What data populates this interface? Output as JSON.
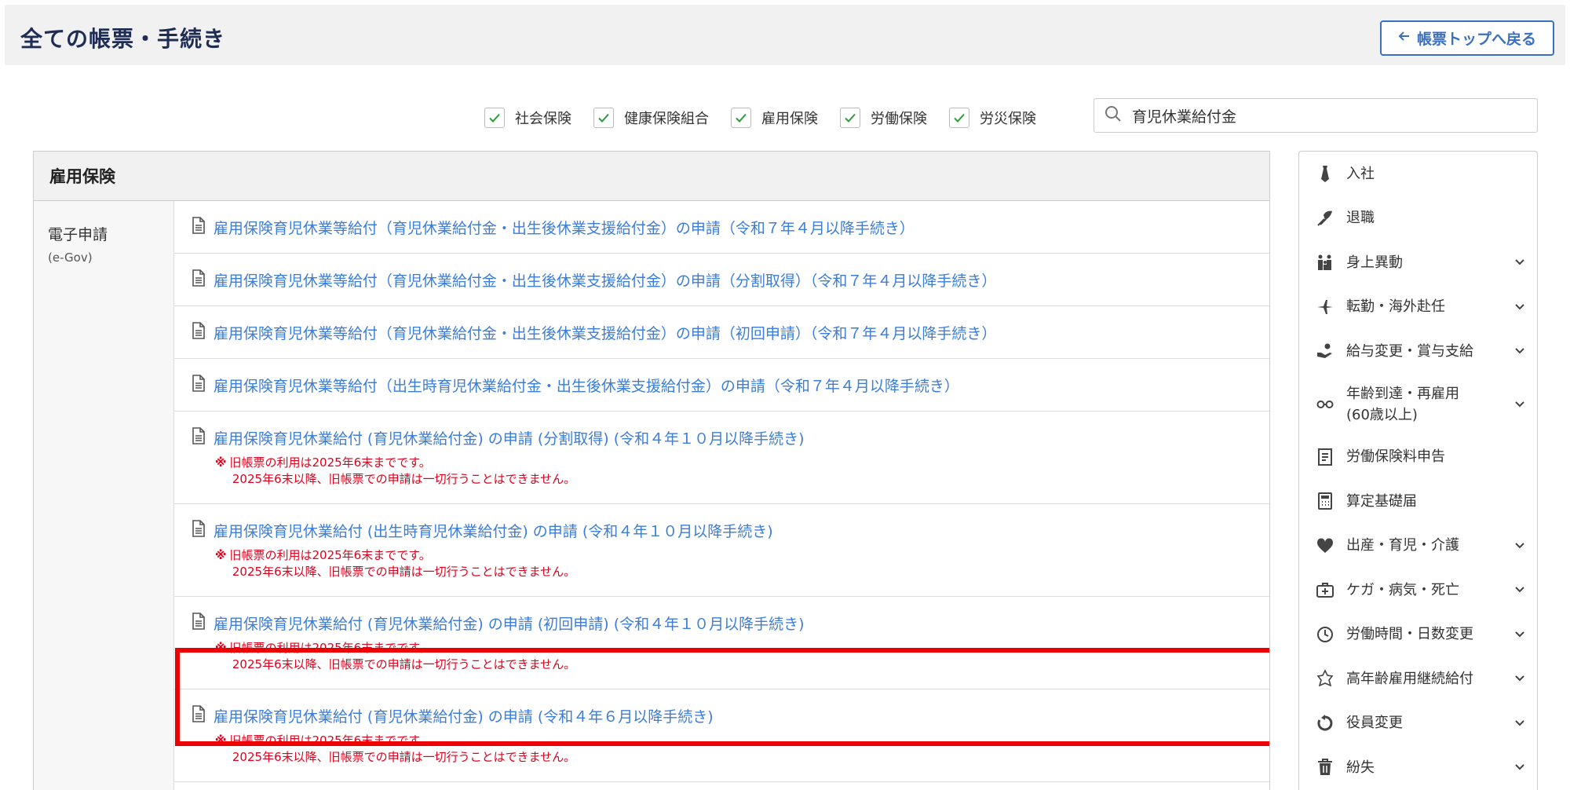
{
  "header": {
    "title": "全ての帳票・手続き",
    "back_label": "帳票トップへ戻る"
  },
  "filters": [
    {
      "label": "社会保険",
      "checked": true
    },
    {
      "label": "健康保険組合",
      "checked": true
    },
    {
      "label": "雇用保険",
      "checked": true
    },
    {
      "label": "労働保険",
      "checked": true
    },
    {
      "label": "労災保険",
      "checked": true
    }
  ],
  "search": {
    "value": "育児休業給付金",
    "placeholder": ""
  },
  "section": {
    "title": "雇用保険",
    "label_main": "電子申請",
    "label_sub": "(e-Gov)",
    "items": [
      {
        "text": "雇用保険育児休業等給付（育児休業給付金・出生後休業支援給付金）の申請（令和７年４月以降手続き）"
      },
      {
        "text": "雇用保険育児休業等給付（育児休業給付金・出生後休業支援給付金）の申請（分割取得）（令和７年４月以降手続き）"
      },
      {
        "text": "雇用保険育児休業等給付（育児休業給付金・出生後休業支援給付金）の申請（初回申請）（令和７年４月以降手続き）"
      },
      {
        "text": "雇用保険育児休業等給付（出生時育児休業給付金・出生後休業支援給付金）の申請（令和７年４月以降手続き）"
      },
      {
        "text": "雇用保険育児休業給付 (育児休業給付金) の申請 (分割取得) (令和４年１０月以降手続き)",
        "note1": "旧帳票の利用は2025年6末までです。",
        "note2": "2025年6末以降、旧帳票での申請は一切行うことはできません。"
      },
      {
        "text": "雇用保険育児休業給付 (出生時育児休業給付金) の申請 (令和４年１０月以降手続き)",
        "note1": "旧帳票の利用は2025年6末までです。",
        "note2": "2025年6末以降、旧帳票での申請は一切行うことはできません。"
      },
      {
        "text": "雇用保険育児休業給付 (育児休業給付金) の申請 (初回申請) (令和４年１０月以降手続き)",
        "note1": "旧帳票の利用は2025年6末までです。",
        "note2": "2025年6末以降、旧帳票での申請は一切行うことはできません。"
      },
      {
        "text": "雇用保険育児休業給付 (育児休業給付金) の申請 (令和４年６月以降手続き)",
        "note1": "旧帳票の利用は2025年6末までです。",
        "note2": "2025年6末以降、旧帳票での申請は一切行うことはできません。"
      }
    ],
    "note_mark": "※",
    "highlighted_index": 6
  },
  "sidebar": {
    "items": [
      {
        "label": "入社",
        "icon": "tie-icon",
        "expandable": false
      },
      {
        "label": "退職",
        "icon": "bouquet-icon",
        "expandable": false
      },
      {
        "label": "身上異動",
        "icon": "family-icon",
        "expandable": true
      },
      {
        "label": "転勤・海外赴任",
        "icon": "airplane-icon",
        "expandable": true
      },
      {
        "label": "給与変更・賞与支給",
        "icon": "money-hand-icon",
        "expandable": true
      },
      {
        "label": "年齢到達・再雇用\n(60歳以上)",
        "icon": "glasses-icon",
        "expandable": true
      },
      {
        "label": "労働保険料申告",
        "icon": "document-lines-icon",
        "expandable": false
      },
      {
        "label": "算定基礎届",
        "icon": "calculator-icon",
        "expandable": false
      },
      {
        "label": "出産・育児・介護",
        "icon": "heart-icon",
        "expandable": true
      },
      {
        "label": "ケガ・病気・死亡",
        "icon": "first-aid-kit-icon",
        "expandable": true
      },
      {
        "label": "労働時間・日数変更",
        "icon": "clock-icon",
        "expandable": true
      },
      {
        "label": "高年齢雇用継続給付",
        "icon": "leaf-icon",
        "expandable": true
      },
      {
        "label": "役員変更",
        "icon": "refresh-icon",
        "expandable": true
      },
      {
        "label": "紛失",
        "icon": "trash-icon",
        "expandable": true
      }
    ]
  },
  "colors": {
    "link": "#3b7dd8",
    "warning": "#e0001c",
    "highlight": "#ee0000",
    "title": "#1f2d55",
    "check": "#2e9c3d"
  }
}
